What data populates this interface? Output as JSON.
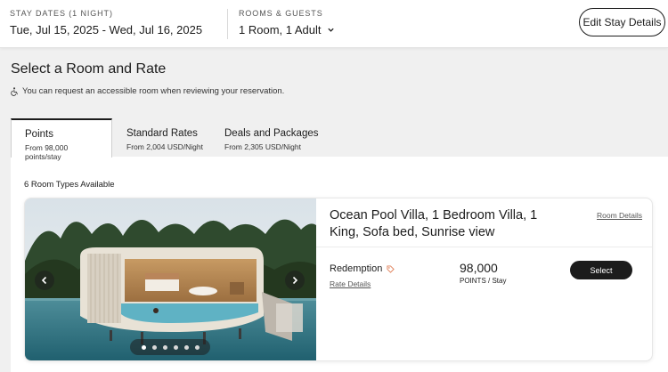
{
  "header": {
    "stay_caption": "STAY DATES (1 NIGHT)",
    "stay_dates": "Tue, Jul 15, 2025 - Wed, Jul 16, 2025",
    "guests_caption": "ROOMS & GUESTS",
    "guests_value": "1 Room, 1 Adult",
    "edit_label": "Edit Stay Details"
  },
  "page": {
    "title": "Select a Room and Rate",
    "accessible_note": "You can request an accessible room when reviewing your reservation."
  },
  "tabs": [
    {
      "label": "Points",
      "sub": "From 98,000 points/stay",
      "active": true
    },
    {
      "label": "Standard Rates",
      "sub": "From 2,004 USD/Night",
      "active": false
    },
    {
      "label": "Deals and Packages",
      "sub": "From 2,305 USD/Night",
      "active": false
    }
  ],
  "results": {
    "count_label": "6 Room Types Available"
  },
  "room": {
    "name": "Ocean Pool Villa, 1 Bedroom Villa, 1 King, Sofa bed, Sunrise view",
    "details_link": "Room Details",
    "rate_name": "Redemption",
    "rate_details_link": "Rate Details",
    "points": "98,000",
    "points_unit": "POINTS / Stay",
    "select_label": "Select",
    "carousel": {
      "slides": 6,
      "active_index": 0
    }
  },
  "colors": {
    "accent_dark": "#1c1c1c",
    "tag_icon": "#e0805a",
    "background": "#f0f0f0"
  }
}
